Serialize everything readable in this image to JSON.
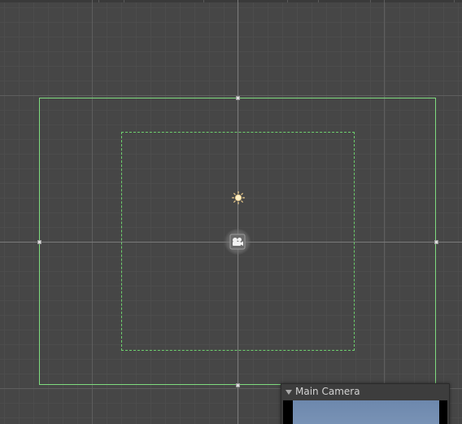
{
  "scene_view": {
    "grid": "on",
    "colors": {
      "background": "#464646",
      "canvas_border": "#7fdc7f",
      "safe_area_border": "#6ed06e"
    },
    "gizmos": [
      "sun-icon",
      "camera-icon"
    ]
  },
  "camera_preview": {
    "title": "Main Camera",
    "expanded": true
  }
}
